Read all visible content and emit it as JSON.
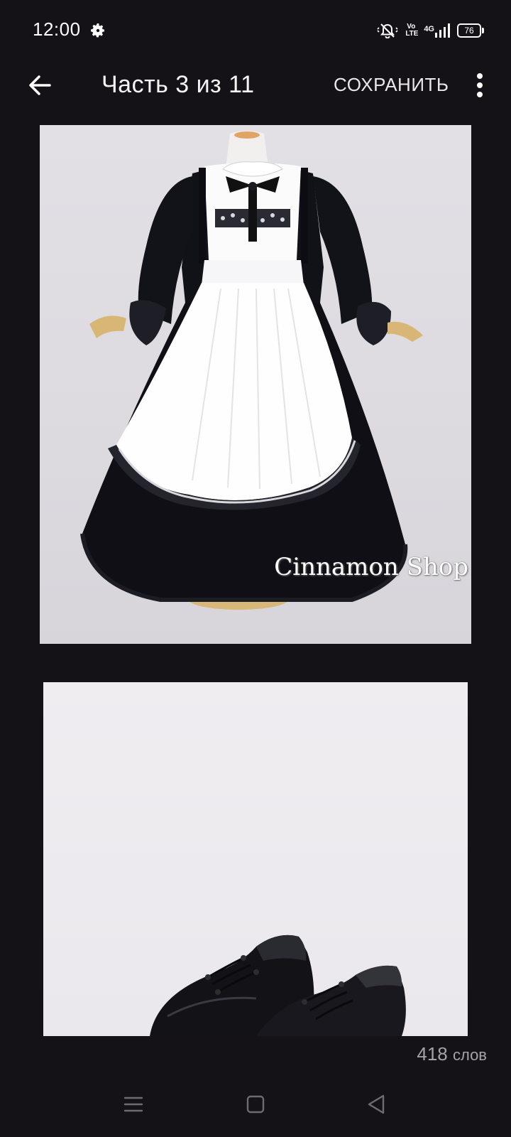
{
  "status_bar": {
    "time": "12:00",
    "icons": [
      "gear-icon",
      "mute-icon",
      "volte-icon",
      "signal-icon",
      "battery-icon"
    ],
    "volte_top": "Vo",
    "volte_bottom": "LTE",
    "network": "4G",
    "battery": "76"
  },
  "app_bar": {
    "title": "Часть 3 из 11",
    "save_label": "СОХРАНИТЬ",
    "back_icon": "arrow-left-icon",
    "more_icon": "more-vertical-icon"
  },
  "content": {
    "images": [
      {
        "name": "maid-dress-image",
        "watermark": "Cinnamon Shop"
      },
      {
        "name": "black-shoes-image"
      }
    ]
  },
  "footer": {
    "word_count": "418",
    "word_unit": "слов"
  },
  "nav_bar": {
    "icons": [
      "menu-icon",
      "home-square-icon",
      "back-triangle-icon"
    ]
  },
  "colors": {
    "background": "#141217",
    "text": "#f1f1f1",
    "muted": "#a4a4a8"
  }
}
